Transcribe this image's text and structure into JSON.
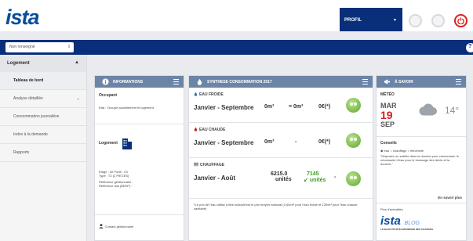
{
  "header": {
    "logo": "ista",
    "profile_label": "PROFIL",
    "profile_caret": "▼"
  },
  "toolbar": {
    "select_value": "Non renseigné",
    "select_chevron": "⇕",
    "help_label": "?"
  },
  "sidebar": {
    "section_title": "Logement",
    "section_chevron": "▲",
    "items": [
      {
        "label": "Tableau de bord",
        "chevron": ""
      },
      {
        "label": "Analyse détaillée",
        "chevron": "»"
      },
      {
        "label": "Consommation journalière",
        "chevron": ""
      },
      {
        "label": "Index à la demande",
        "chevron": ""
      },
      {
        "label": "Rapports",
        "chevron": ""
      }
    ]
  },
  "info_panel": {
    "title": "INFORMATIONS",
    "occupant_label": "Occupant",
    "etat_text": "Etat : Occupé actuellement le logement",
    "logement_label": "Logement",
    "etage_text": "Etage : 00  Porte : 03",
    "type_text": "Type : T2 (2 PIECES)",
    "ref_gest": "Référence gestionnaire :",
    "ref_ista": "Référence ista (BEEP) :",
    "contact_label": "Contact gestionnaire"
  },
  "conso_panel": {
    "title": "SYNTHESE CONSOMMATION 2017",
    "rows": [
      {
        "title": "EAU FROIDE",
        "period": "Janvier - Septembre",
        "v1": "0m³",
        "v2": "= 0m³",
        "v3": "0€(*)"
      },
      {
        "title": "EAU CHAUDE",
        "period": "Janvier - Septembre",
        "v1": "0m³",
        "v2": "-",
        "v3": "0€(*)"
      },
      {
        "title": "CHAUFFAGE",
        "period": "Janvier - Août",
        "v1": "6215.0",
        "v1b": "unités",
        "v2": "7145",
        "v2b": "unités",
        "v3": "-"
      }
    ],
    "footnote": "*Le prix de l'eau utilisé à titre indicatif est le prix moyen national (3,40/m³ pour l'eau froide et 12€/m³ pour l'eau chaude sanitaire)"
  },
  "savoir_panel": {
    "title": "À SAVOIR",
    "meteo_label": "MÉTÉO",
    "weekday": "MAR",
    "day": "19",
    "month": "SEP",
    "temperature": "14°",
    "conseils_label": "Conseils",
    "radio_options": [
      "eau",
      "chauffage",
      "électricité"
    ],
    "conseil_text": "\"Disposez un sablier dans la douche pour consommer le nécessaire d'eau pour le brossage des dents et la douche.\"",
    "more_link": "En savoir plus",
    "news_label": "Plus d'actualités",
    "blog_logo": "ista",
    "blog_word": "BLOG",
    "blog_tagline": "LE BLOG POUR ÉCONOMISER DES CHARGES"
  },
  "colors": {
    "brand_blue": "#0a2f7a",
    "panel_header": "#6c85a6",
    "eco_green": "#3f9a22",
    "alert_red": "#d01f1f"
  }
}
